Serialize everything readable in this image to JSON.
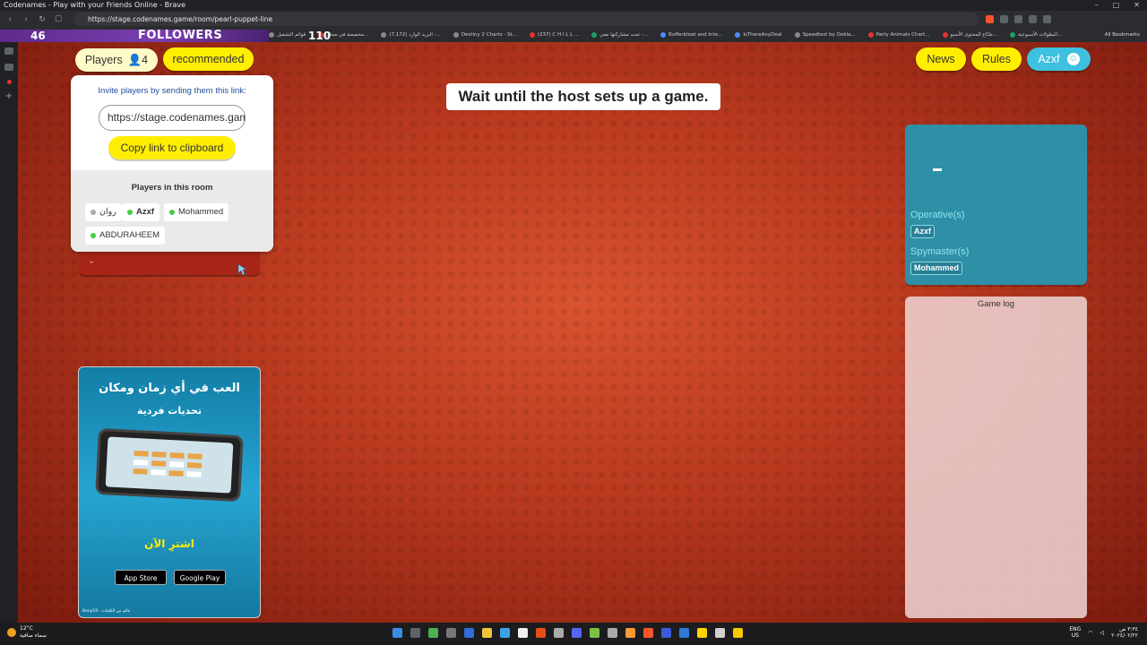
{
  "browser": {
    "window_title": "Codenames - Play with your Friends Online - Brave",
    "url": "https://stage.codenames.game/room/pearl-puppet-line",
    "bookmarks": [
      "قوائم التشغيل",
      "مخصصة في مجال...",
      "البريد الوارد (7,172) -...",
      "Destiny 2 Charts · St...",
      "(237) C H I L L ...",
      "تحت مشاركتها معي -...",
      "Bufferbloat and Inte...",
      "IsThereAnyDeal",
      "Speedtest by Ookla...",
      "Party Animals Chart...",
      "صُنّاع المحتوى الأسبو...",
      "البطولات الأسبوعية..."
    ],
    "all_bookmarks": "All Bookmarks"
  },
  "stream_overlay": {
    "count_left": "46",
    "label": "FOLLOWERS",
    "count_right": "110"
  },
  "game": {
    "players_label": "Players",
    "players_count": "4",
    "recommended_label": "recommended",
    "news_label": "News",
    "rules_label": "Rules",
    "user_label": "Azxf",
    "status_message": "Wait until the host sets up a game.",
    "invite": {
      "hint": "Invite players by sending them this link:",
      "link": "https://stage.codenames.game/room/pearl-puppet-line",
      "copy_label": "Copy link to clipboard",
      "players_heading": "Players in this room",
      "players": [
        {
          "name": "روان",
          "status_color": "#aaaaaa"
        },
        {
          "name": "Azxf",
          "status_color": "#44cc44"
        },
        {
          "name": "Mohammed",
          "status_color": "#44cc44"
        },
        {
          "name": "ABDURAHEEM",
          "status_color": "#44cc44"
        }
      ]
    },
    "red_team_bar": "–",
    "blue_team": {
      "score": "–",
      "operatives_label": "Operative(s)",
      "operative": "Azxf",
      "spymaster_label": "Spymaster(s)",
      "spymaster": "Mohammed"
    },
    "game_log_label": "Game log",
    "ad": {
      "headline": "العب في أي زمان ومكان",
      "subline": "تحديات فردية",
      "cta": "اشترِ الآن",
      "app_store": "App Store",
      "google_play": "Google Play",
      "footer": "Bouy19 · عالم من الكلمات"
    }
  },
  "taskbar": {
    "temperature": "12°C",
    "weather_text": "سماء صافية",
    "lang_line1": "ENG",
    "lang_line2": "US",
    "time": "٣:٣٤ ص",
    "date": "٢٠٢٤/٠٢/٢٢"
  },
  "colors": {
    "accent_yellow": "#ffee00",
    "red_team": "#b7381e",
    "blue_team": "#2e8fa6"
  }
}
